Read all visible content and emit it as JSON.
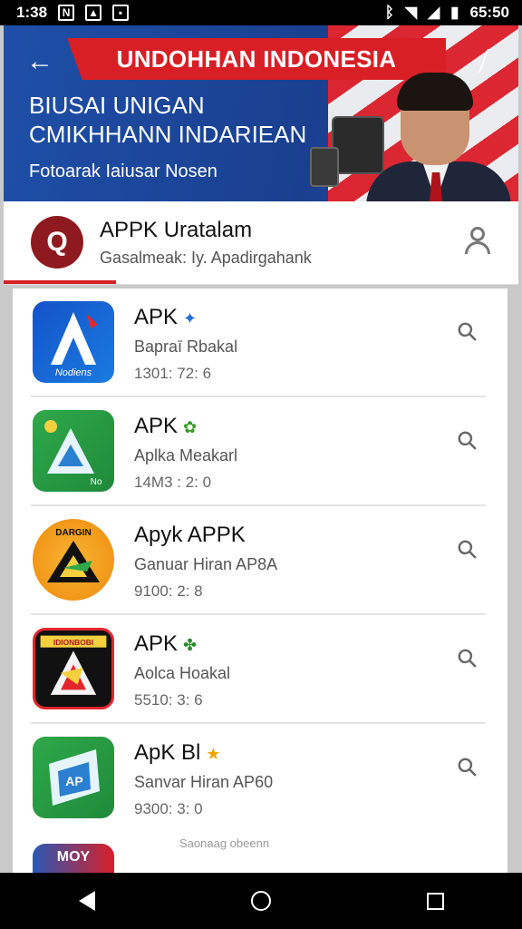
{
  "status_bar": {
    "time": "1:38",
    "icons_left": [
      "notification-n-icon",
      "image-icon",
      "gallery-icon"
    ],
    "icons_right": [
      "bluetooth-icon",
      "wifi-icon",
      "signal-icon",
      "battery-icon"
    ],
    "right_text": "65:50"
  },
  "banner": {
    "headline": "UNDOHHAN INDONESIA",
    "line1": "BIUSAI UNIGAN",
    "line2": "CMIKHHANN INDARIEAN",
    "subtitle": "Fotoarak Iaiusar Nosen",
    "colors": {
      "blue": "#1e4fa8",
      "red": "#d81f26"
    }
  },
  "header": {
    "logo_glyph": "Q",
    "title": "APPK Uratalam",
    "subtitle": "Gasalmeak: Iy. Apadirgahank"
  },
  "list": {
    "items": [
      {
        "title": "APK",
        "badge": "✦",
        "developer": "Bapraī Rbakal",
        "meta": "1301: 72: 6",
        "icon_text": "Nodiens",
        "icon_colors": [
          "#1452c9",
          "#1a7be0"
        ]
      },
      {
        "title": "APK",
        "badge": "✿",
        "developer": "Aplka Meakarl",
        "meta": "14M3 : 2: 0",
        "icon_text": "No",
        "icon_colors": [
          "#2fa84a",
          "#1f8a3a"
        ]
      },
      {
        "title": "Apyk APPK",
        "badge": "",
        "developer": "Ganuar Hiran AP8A",
        "meta": "9100: 2: 8",
        "icon_text": "DARGIN",
        "icon_colors": [
          "#f6a21d",
          "#f28a0c"
        ]
      },
      {
        "title": "APK",
        "badge": "✤",
        "developer": "Aolca Hoakal",
        "meta": "5510: 3: 6",
        "icon_text": "IDIONBOBI",
        "icon_colors": [
          "#111111",
          "#1d1d1d"
        ]
      },
      {
        "title": "ApK Bl",
        "badge": "★",
        "developer": "Sanvar Hiran AP60",
        "meta": "9300: 3: 0",
        "icon_text": "AP",
        "icon_colors": [
          "#2fa84a",
          "#1f8a3a"
        ]
      }
    ],
    "footer_peek": "MOY",
    "footer_text": "Saonaag obeenn"
  }
}
